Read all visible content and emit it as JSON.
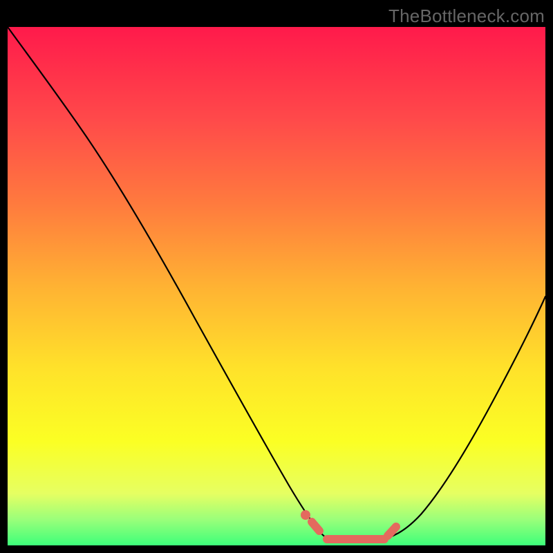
{
  "watermark": "TheBottleneck.com",
  "colors": {
    "gradient_top": "#ff1a4b",
    "gradient_bottom": "#3dff7a",
    "curve": "#000000",
    "highlight": "#e46a5e",
    "background": "#000000"
  },
  "chart_data": {
    "type": "line",
    "title": "",
    "xlabel": "",
    "ylabel": "",
    "xlim": [
      0,
      100
    ],
    "ylim": [
      0,
      100
    ],
    "x": [
      0,
      5,
      10,
      15,
      20,
      25,
      30,
      35,
      40,
      45,
      50,
      55,
      60,
      63,
      65,
      67,
      70,
      75,
      80,
      85,
      90,
      95,
      100
    ],
    "values": [
      100,
      96,
      90,
      83,
      75,
      66,
      56,
      47,
      37,
      28,
      19,
      11,
      5,
      2,
      1,
      0.7,
      0.7,
      1,
      5,
      13,
      24,
      37,
      50
    ],
    "annotations": {
      "optimal_range_x": [
        55,
        72
      ],
      "optimal_range_y_approx": 0.7,
      "left_marker_x": 55.5,
      "right_marker_x": 69
    }
  }
}
